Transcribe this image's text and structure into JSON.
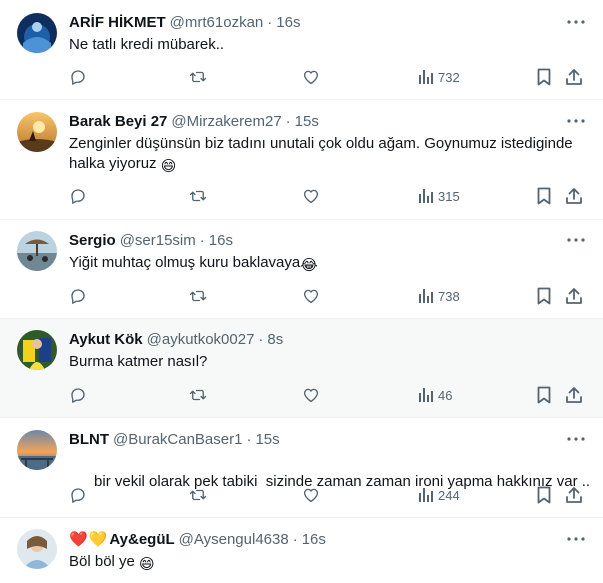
{
  "colors": {
    "text": "#0f1419",
    "muted": "#536471",
    "border": "#eff3f4",
    "hover_bg": "#f7f9f9"
  },
  "icons": [
    "more-dots-icon",
    "reply-icon",
    "retweet-icon",
    "like-icon",
    "views-icon",
    "bookmark-icon",
    "share-icon"
  ],
  "tweets": [
    {
      "name": "ARİF HİKMET",
      "handle": "@mrt61ozkan",
      "dot": "·",
      "time": "16s",
      "text": "Ne tatlı kredi mübarek..",
      "views": "732"
    },
    {
      "name": "Barak Beyi 27",
      "handle": "@Mirzakerem27",
      "dot": "·",
      "time": "15s",
      "text": "Zenginler düşünsün biz tadını unutali çok oldu ağam. Goynumuz istediginde halka yiyoruz",
      "emoji": "😄",
      "views": "315"
    },
    {
      "name": "Sergio",
      "handle": "@ser15sim",
      "dot": "·",
      "time": "16s",
      "text": "Yiğit muhtaç olmuş kuru baklavaya",
      "emoji": "😂",
      "views": "738"
    },
    {
      "name": "Aykut Kök",
      "handle": "@aykutkok0027",
      "dot": "·",
      "time": "8s",
      "text": "Burma katmer nasıl?",
      "views": "46"
    },
    {
      "name": "BLNT",
      "handle": "@BurakCanBaser1",
      "dot": "·",
      "time": "15s",
      "text": "bir vekil olarak pek tabiki  sizinde zaman zaman ironi yapma hakkınız var ..",
      "views": "244"
    },
    {
      "name": "Ay&egüL",
      "name_hearts": [
        "❤️",
        "💛"
      ],
      "handle": "@Aysengul4638",
      "dot": "·",
      "time": "16s",
      "text": "Böl böl ye",
      "emoji": "😄"
    }
  ]
}
